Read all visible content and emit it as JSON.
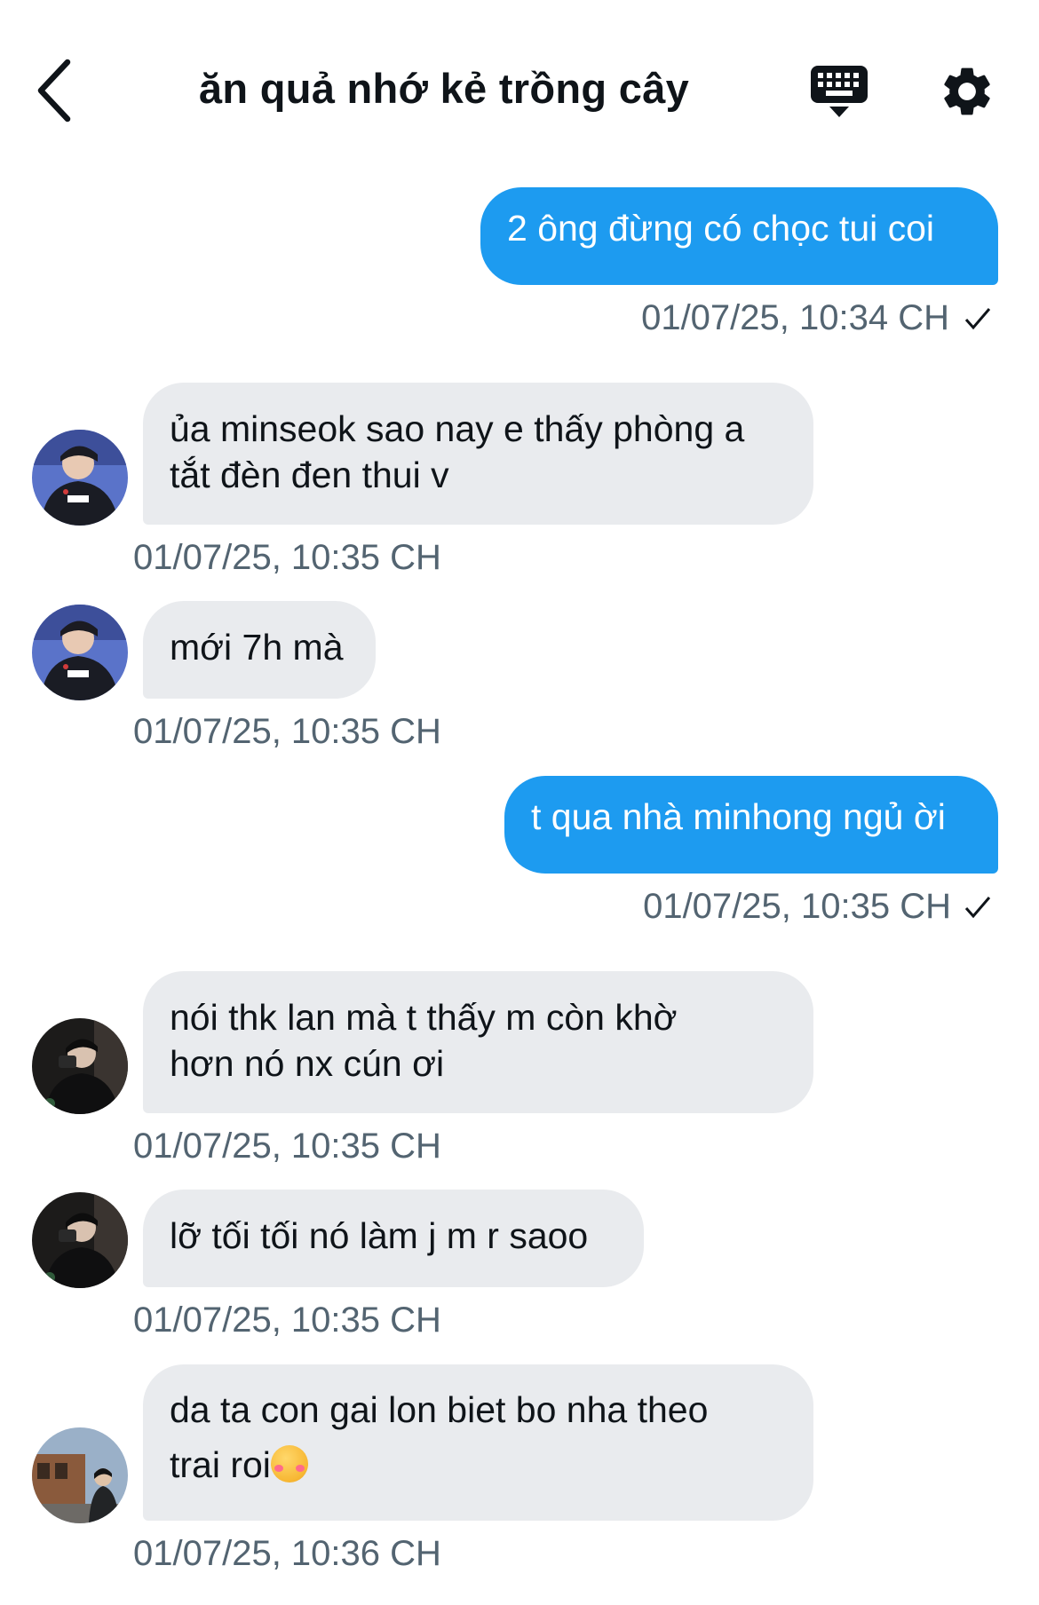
{
  "header": {
    "title": "ăn quả nhớ kẻ trồng cây"
  },
  "messages": [
    {
      "dir": "out",
      "text": "2 ông đừng có chọc tui coi",
      "time": "01/07/25, 10:34 CH"
    },
    {
      "dir": "in",
      "lines": [
        "ủa minseok sao nay e thấy phòng a",
        "tắt đèn đen thui v"
      ],
      "time": "01/07/25, 10:35 CH"
    },
    {
      "dir": "in",
      "text": "mới 7h mà",
      "time": "01/07/25, 10:35 CH"
    },
    {
      "dir": "out",
      "text": "t qua nhà minhong ngủ ời",
      "time": "01/07/25, 10:35 CH"
    },
    {
      "dir": "in",
      "lines": [
        "nói thk lan mà t thấy m còn khờ",
        "hơn nó nx cún ơi"
      ],
      "time": "01/07/25, 10:35 CH"
    },
    {
      "dir": "in",
      "text": "lỡ tối tối nó làm j m r saoo",
      "time": "01/07/25, 10:35 CH"
    },
    {
      "dir": "in",
      "lines": [
        "da ta con gai lon biet bo nha theo",
        "trai roi"
      ],
      "emoji": "smiling-face-with-hearts",
      "time": "01/07/25, 10:36 CH"
    }
  ],
  "colors": {
    "outgoing_bubble": "#1d9bf0",
    "incoming_bubble": "#e9ebee",
    "timestamp": "#536471"
  }
}
